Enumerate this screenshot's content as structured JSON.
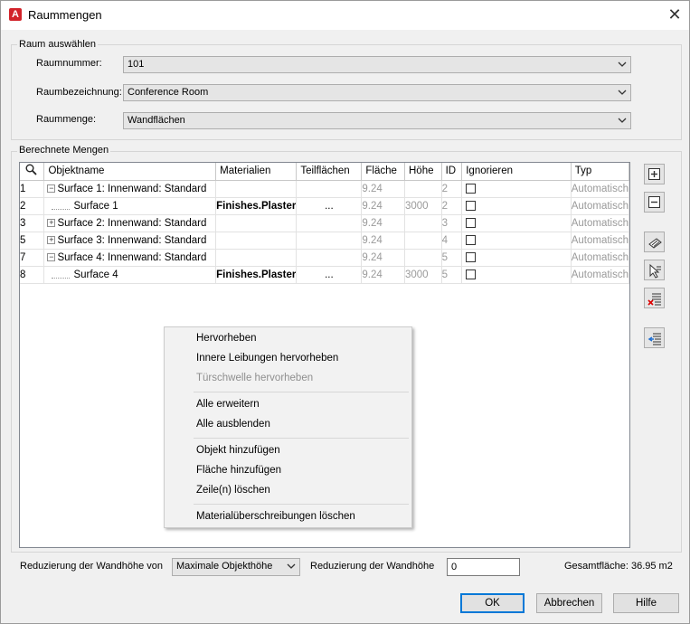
{
  "window": {
    "title": "Raummengen",
    "app_icon_letter": "A",
    "close_glyph": "✕"
  },
  "raum": {
    "group_label": "Raum auswählen",
    "raumnummer_label": "Raumnummer:",
    "raumnummer_value": "101",
    "raumbezeichnung_label": "Raumbezeichnung:",
    "raumbezeichnung_value": "Conference Room",
    "raummenge_label": "Raummenge:",
    "raummenge_value": "Wandflächen"
  },
  "mengen": {
    "group_label": "Berechnete Mengen",
    "columns": [
      "Objektname",
      "Materialien",
      "Teilflächen",
      "Fläche",
      "Höhe",
      "ID",
      "Ignorieren",
      "Typ"
    ],
    "rows": [
      {
        "num": "1",
        "expander": "−",
        "name": "Surface 1: Innenwand: Standard",
        "material": "",
        "teil": "",
        "flaeche": "9.24",
        "hoehe": "",
        "id": "2",
        "typ": "Automatisch",
        "child": false
      },
      {
        "num": "2",
        "expander": "",
        "name": "Surface 1",
        "material": "Finishes.Plaster",
        "teil": "...",
        "flaeche": "9.24",
        "hoehe": "3000",
        "id": "2",
        "typ": "Automatisch",
        "child": true
      },
      {
        "num": "3",
        "expander": "+",
        "name": "Surface 2: Innenwand: Standard",
        "material": "",
        "teil": "",
        "flaeche": "9.24",
        "hoehe": "",
        "id": "3",
        "typ": "Automatisch",
        "child": false
      },
      {
        "num": "5",
        "expander": "+",
        "name": "Surface 3: Innenwand: Standard",
        "material": "",
        "teil": "",
        "flaeche": "9.24",
        "hoehe": "",
        "id": "4",
        "typ": "Automatisch",
        "child": false
      },
      {
        "num": "7",
        "expander": "−",
        "name": "Surface 4: Innenwand: Standard",
        "material": "",
        "teil": "",
        "flaeche": "9.24",
        "hoehe": "",
        "id": "5",
        "typ": "Automatisch",
        "child": false
      },
      {
        "num": "8",
        "expander": "",
        "name": "Surface 4",
        "material": "Finishes.Plaster",
        "teil": "...",
        "flaeche": "9.24",
        "hoehe": "3000",
        "id": "5",
        "typ": "Automatisch",
        "child": true
      }
    ]
  },
  "context_menu": {
    "items": [
      {
        "label": "Hervorheben",
        "disabled": false
      },
      {
        "label": "Innere Leibungen hervorheben",
        "disabled": false
      },
      {
        "label": "Türschwelle hervorheben",
        "disabled": true
      },
      {
        "label": "Alle erweitern",
        "disabled": false
      },
      {
        "label": "Alle ausblenden",
        "disabled": false
      },
      {
        "label": "Objekt hinzufügen",
        "disabled": false
      },
      {
        "label": "Fläche hinzufügen",
        "disabled": false
      },
      {
        "label": "Zeile(n) löschen",
        "disabled": false
      },
      {
        "label": "Materialüberschreibungen löschen",
        "disabled": false
      }
    ]
  },
  "bottom": {
    "reduzierung_von_label": "Reduzierung der Wandhöhe von",
    "reduzierung_von_value": "Maximale Objekthöhe",
    "reduzierung_label": "Reduzierung der Wandhöhe",
    "reduzierung_value": "0",
    "gesamtflaeche": "Gesamtfläche: 36.95 m2"
  },
  "buttons": {
    "ok": "OK",
    "abbrechen": "Abbrechen",
    "hilfe": "Hilfe"
  }
}
